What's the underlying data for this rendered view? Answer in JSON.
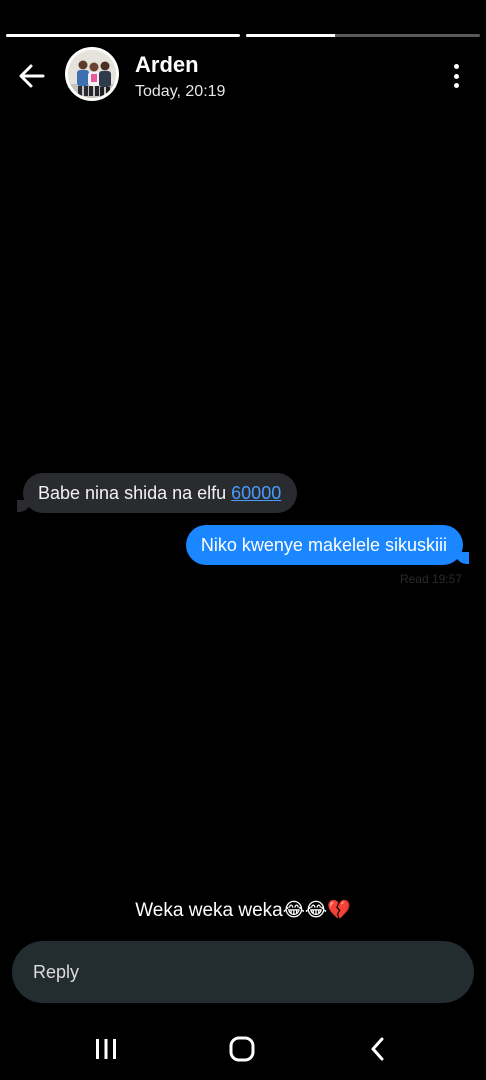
{
  "story": {
    "progress": [
      1.0,
      0.38
    ]
  },
  "header": {
    "contact_name": "Arden",
    "timestamp": "Today, 20:19",
    "back_icon": "arrow-left-icon",
    "menu_icon": "more-vertical-icon"
  },
  "conversation": {
    "incoming": {
      "text": "Babe nina shida na elfu ",
      "link": "60000"
    },
    "outgoing": {
      "text": "Niko kwenye makelele sikuskiii"
    },
    "read_status": "Read 19:57"
  },
  "caption": {
    "text": "Weka weka weka😂😂💔"
  },
  "reply": {
    "placeholder": "Reply"
  },
  "navigation": {
    "icons": [
      "recents-icon",
      "home-icon",
      "back-chevron-icon"
    ]
  },
  "colors": {
    "outgoing_bubble": "#1a86ff",
    "incoming_bubble": "#2a2b2e",
    "link": "#4a9bff",
    "reply_box": "#232c30"
  }
}
